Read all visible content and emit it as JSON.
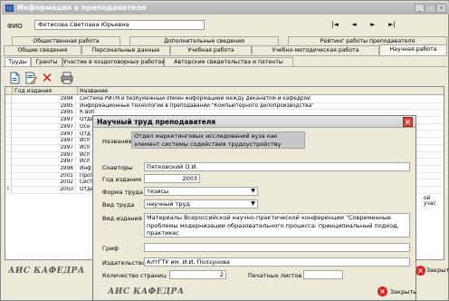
{
  "window": {
    "title": "Информация о преподавателе",
    "minimize_glyph": "_",
    "maximize_glyph": "□",
    "close_glyph": "×"
  },
  "fio": {
    "label": "ФИО",
    "value": "Фетисова Светлана Юрьевна"
  },
  "nav": [
    "|◄",
    "◄",
    "►",
    "►|"
  ],
  "tabs_row1": [
    "Общественная работа",
    "Дополнительные сведения",
    "Рейтинг работы преподавателя"
  ],
  "tabs_row2": [
    "Общие сведения",
    "Персональные данные",
    "Учебная работа",
    "Учебно-методическая работа",
    "Научная работа"
  ],
  "subtabs": [
    "Труды",
    "Гранты",
    "Участие в хоздоговорных работах",
    "Авторские свидетельства и патенты"
  ],
  "toolbar": {
    "icons": [
      "new-doc-icon",
      "edit-doc-icon",
      "delete-icon",
      "print-icon"
    ],
    "delete_glyph": "✕"
  },
  "grid": {
    "headers": [
      "Год издания",
      "Название"
    ],
    "rows": [
      {
        "ind": "",
        "year": "1994",
        "name": "Система РИТМ и безбумажный обмен информацией между деканатом и кафедрой"
      },
      {
        "ind": "",
        "year": "1995",
        "name": "Информационные технологии в преподавании \"Компьютерного делопроизводства\""
      },
      {
        "ind": "",
        "year": "1995",
        "name": "К воп"
      },
      {
        "ind": "",
        "year": "1997",
        "name": "Отде"
      },
      {
        "ind": "",
        "year": "1997",
        "name": "Осн"
      },
      {
        "ind": "",
        "year": "1997",
        "name": "Отд"
      },
      {
        "ind": "",
        "year": "1997",
        "name": "Исп"
      },
      {
        "ind": "",
        "year": "1997",
        "name": "Исп"
      },
      {
        "ind": "",
        "year": "1997",
        "name": "Исп"
      },
      {
        "ind": "",
        "year": "1997",
        "name": "Исп"
      },
      {
        "ind": "",
        "year": "1998",
        "name": "Инф"
      },
      {
        "ind": "",
        "year": "2001",
        "name": "Прог"
      },
      {
        "ind": "",
        "year": "2002",
        "name": "Сист"
      },
      {
        "ind": "I",
        "year": "2003",
        "name": "Отде"
      }
    ],
    "right_overflow_text": "ой учас"
  },
  "status": {
    "brand": "АИС КАФЕДРА",
    "close_label": "Закрыть"
  },
  "dialog": {
    "title": "Научный труд преподавателя",
    "fields": {
      "name_label": "Название",
      "name_value": "Отдел маркетинговых исследований вуза как элемент системы содействия трудоустройству выпускников",
      "coauthors_label": "Соавторы",
      "coauthors_value": "Пятковский О.И.",
      "year_label": "Год издания",
      "year_value": "2003",
      "form_label": "Форма труда",
      "form_value": "тезисы",
      "type_label": "Вид труда",
      "type_value": "научный труд",
      "edition_label": "Вид издания",
      "edition_value": "Материалы Всероссийской научно-практической конференции \"Современные проблемы модернизации образовательного процесса: принципиальный подход, практикес",
      "grif_label": "Гриф",
      "grif_value": "",
      "publisher_label": "Издательство",
      "publisher_value": "АлтГТУ им. И.И. Ползунова",
      "pages_label": "Количество страниц",
      "pages_value": "2",
      "sheets_label": "Печатных листов",
      "sheets_value": ""
    },
    "brand": "АИС КАФЕДРА",
    "close_label": "Закрыть"
  },
  "colors": {
    "title_bar": "#b8b8b8",
    "window_bg": "#ece9d8",
    "close_red": "#d22222",
    "selection": "#c8c8c8"
  }
}
